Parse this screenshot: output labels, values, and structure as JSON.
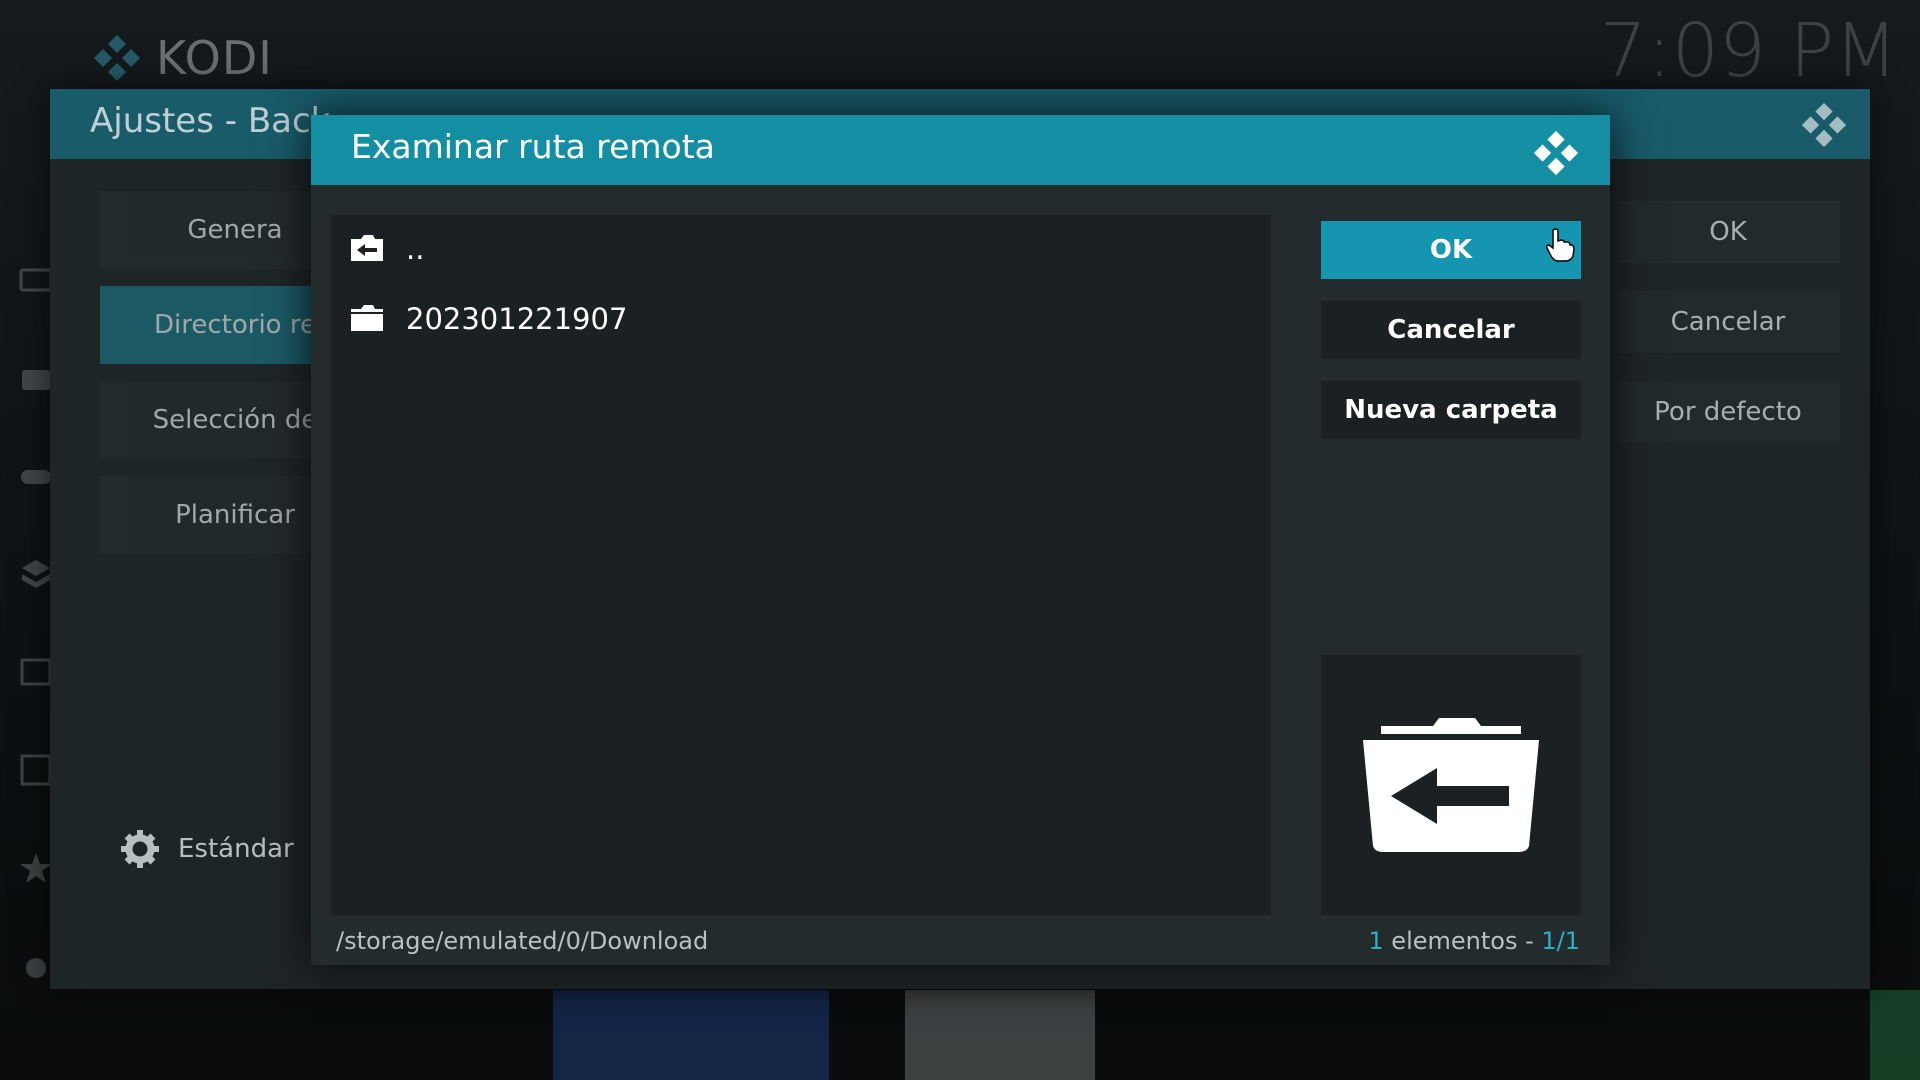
{
  "home": {
    "app_name": "KODI",
    "clock": "7:09 PM"
  },
  "settings": {
    "title": "Ajustes - Back",
    "menu": [
      {
        "label": "Genera",
        "active": false
      },
      {
        "label": "Directorio re",
        "active": true
      },
      {
        "label": "Selección de",
        "active": false
      },
      {
        "label": "Planificar",
        "active": false
      }
    ],
    "buttons": {
      "ok": "OK",
      "cancel": "Cancelar",
      "default": "Por defecto"
    },
    "level": "Estándar"
  },
  "dialog": {
    "title": "Examinar ruta remota",
    "items": [
      {
        "label": "..",
        "icon": "folder-back-icon"
      },
      {
        "label": "202301221907",
        "icon": "folder-icon"
      }
    ],
    "buttons": {
      "ok": "OK",
      "cancel": "Cancelar",
      "new_folder": "Nueva carpeta"
    },
    "path": "/storage/emulated/0/Download",
    "count_number": "1",
    "count_text": " elementos - ",
    "page": "1/1"
  },
  "colors": {
    "accent": "#148ea3",
    "focused": "#1595b0",
    "panel": "#232b2d"
  }
}
